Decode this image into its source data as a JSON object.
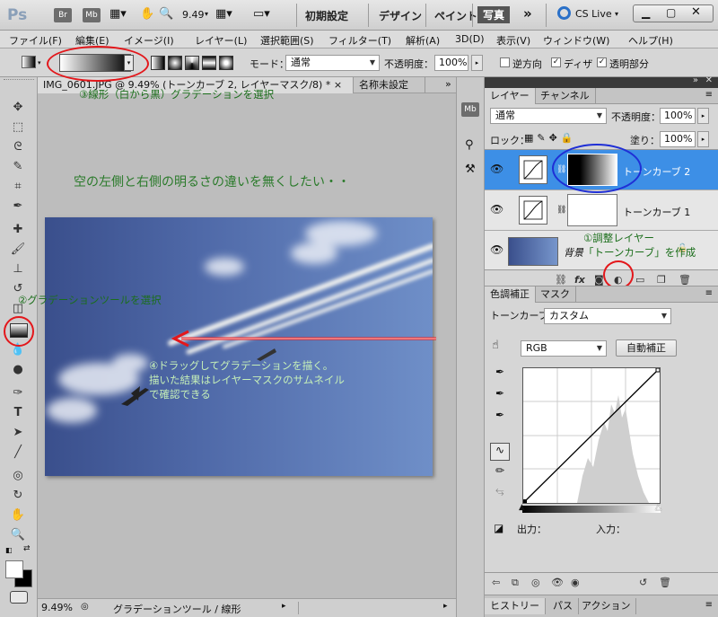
{
  "app": {
    "logo": "Ps",
    "bridge_label": "Br",
    "minibridge_label": "Mb",
    "zoom": "9.49",
    "workspaces": [
      "初期設定",
      "デザイン",
      "ペイント",
      "写真"
    ],
    "more_label": "»",
    "cslive_label": "CS Live"
  },
  "menu": [
    "ファイル(F)",
    "編集(E)",
    "イメージ(I)",
    "レイヤー(L)",
    "選択範囲(S)",
    "フィルター(T)",
    "解析(A)",
    "3D(D)",
    "表示(V)",
    "ウィンドウ(W)",
    "ヘルプ(H)"
  ],
  "options": {
    "mode_label": "モード：",
    "mode_value": "通常",
    "opacity_label": "不透明度：",
    "opacity_value": "100%",
    "reverse_label": "逆方向",
    "dither_label": "ディザ",
    "transparency_label": "透明部分",
    "reverse_checked": false,
    "dither_checked": true,
    "transparency_checked": true
  },
  "document": {
    "tab1": "IMG_0601.JPG @ 9.49% (トーンカーブ 2, レイヤーマスク/8) * ×",
    "tab2": "名称未設定"
  },
  "status": {
    "zoom": "9.49%",
    "info": "グラデーションツール / 線形"
  },
  "annotations": {
    "a3": "③線形（白から黒）グラデーションを選択",
    "title": "空の左側と右側の明るさの違いを無くしたい・・",
    "a2": "②グラデーションツールを選択",
    "a4_line1": "④ドラッグしてグラデーションを描く。",
    "a4_line2": "描いた結果はレイヤーマスクのサムネイル",
    "a4_line3": "で確認できる",
    "a1_line1": "①調整レイヤー",
    "a1_line2": "「トーンカーブ」を作成"
  },
  "layers_panel": {
    "tab_layers": "レイヤー",
    "tab_channels": "チャンネル",
    "blend_mode": "通常",
    "opacity_label": "不透明度：",
    "opacity_value": "100%",
    "lock_label": "ロック：",
    "fill_label": "塗り：",
    "fill_value": "100%",
    "layers": [
      {
        "name": "トーンカーブ 2",
        "selected": true
      },
      {
        "name": "トーンカーブ 1",
        "selected": false
      },
      {
        "name": "背景",
        "selected": false
      }
    ]
  },
  "adjust_panel": {
    "tab_adjust": "色調補正",
    "tab_mask": "マスク",
    "curve_label": "トーンカーブ",
    "preset_value": "カスタム",
    "channel_value": "RGB",
    "auto_button": "自動補正",
    "output_label": "出力：",
    "input_label": "入力："
  },
  "bottom_tabs": [
    "ヒストリー",
    "パス",
    "アクション"
  ],
  "colors": {
    "annotation_green": "#1b6e1b",
    "highlight_red": "#e3171b",
    "highlight_blue": "#1f2fd6",
    "selected_layer": "#3d8fe6"
  }
}
